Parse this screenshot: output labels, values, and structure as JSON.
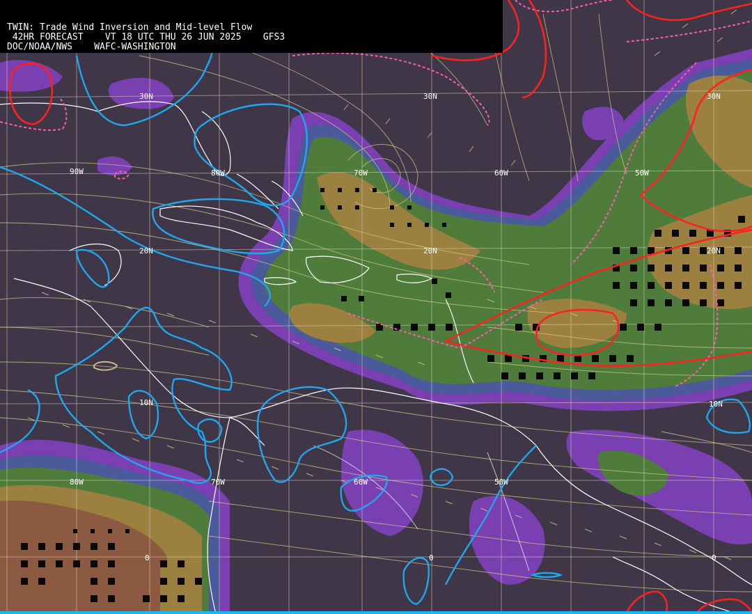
{
  "header": {
    "title": "TWIN: Trade Wind Inversion and Mid-level Flow",
    "forecast_line": " 42HR FORECAST    VT 18 UTC THU 26 JUN 2025    GFS3",
    "agency_line": "DOC/NOAA/NWS    WAFC-WASHINGTON"
  },
  "grid_labels": {
    "lat_30n_west": "30N",
    "lat_30n_mid": "30N",
    "lat_30n_east": "30N",
    "lat_20n_west": "20N",
    "lat_20n_mid": "20N",
    "lat_20n_east": "20N",
    "lat_10n_west": "10N",
    "lat_10n_east": "10N",
    "lat_0_west": "0",
    "lat_0_mid": "0",
    "lat_0_east": "0",
    "lon_90w": "90W",
    "lon_80w": "80W",
    "lon_70w": "70W",
    "lon_60w": "60W",
    "lon_50w": "50W",
    "lon_80w_south": "80W",
    "lon_70w_south": "70W",
    "lon_60w_south": "60W",
    "lon_50w_south": "50W"
  },
  "colors": {
    "background": "#3f3748",
    "purple_band": "#7a3fb0",
    "blue_band": "#4a5a9a",
    "green_band": "#4f7c3a",
    "tan_band": "#9b8040",
    "brown_band": "#8c5a40",
    "inversion_contour": "#1ea8f0",
    "high_contour": "#ff2020",
    "dashed_contour": "#ff5cb0",
    "streamline": "#d8cf8a",
    "coastline": "#ffffff"
  }
}
